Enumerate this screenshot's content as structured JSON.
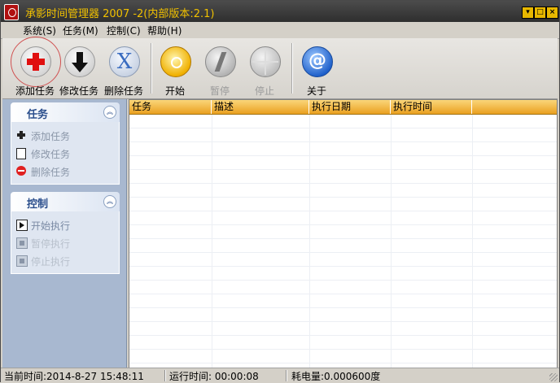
{
  "window": {
    "title": "承影时间管理器 2007 -2(内部版本:2.1)"
  },
  "menu": [
    "系统(S)",
    "任务(M)",
    "控制(C)",
    "帮助(H)"
  ],
  "toolbar": {
    "add": "添加任务",
    "edit": "修改任务",
    "delete": "删除任务",
    "start": "开始",
    "pause": "暂停",
    "stop": "停止",
    "about": "关于"
  },
  "sidebar": {
    "tasks": {
      "title": "任务",
      "items": [
        "添加任务",
        "修改任务",
        "删除任务"
      ]
    },
    "control": {
      "title": "控制",
      "items": [
        "开始执行",
        "暂停执行",
        "停止执行"
      ]
    }
  },
  "table": {
    "columns": [
      "任务",
      "描述",
      "执行日期",
      "执行时间"
    ]
  },
  "status": {
    "current_time": "当前时间:2014-8-27 15:48:11",
    "run_time": "运行时间: 00:00:08",
    "power": "耗电量:0.000600度"
  }
}
